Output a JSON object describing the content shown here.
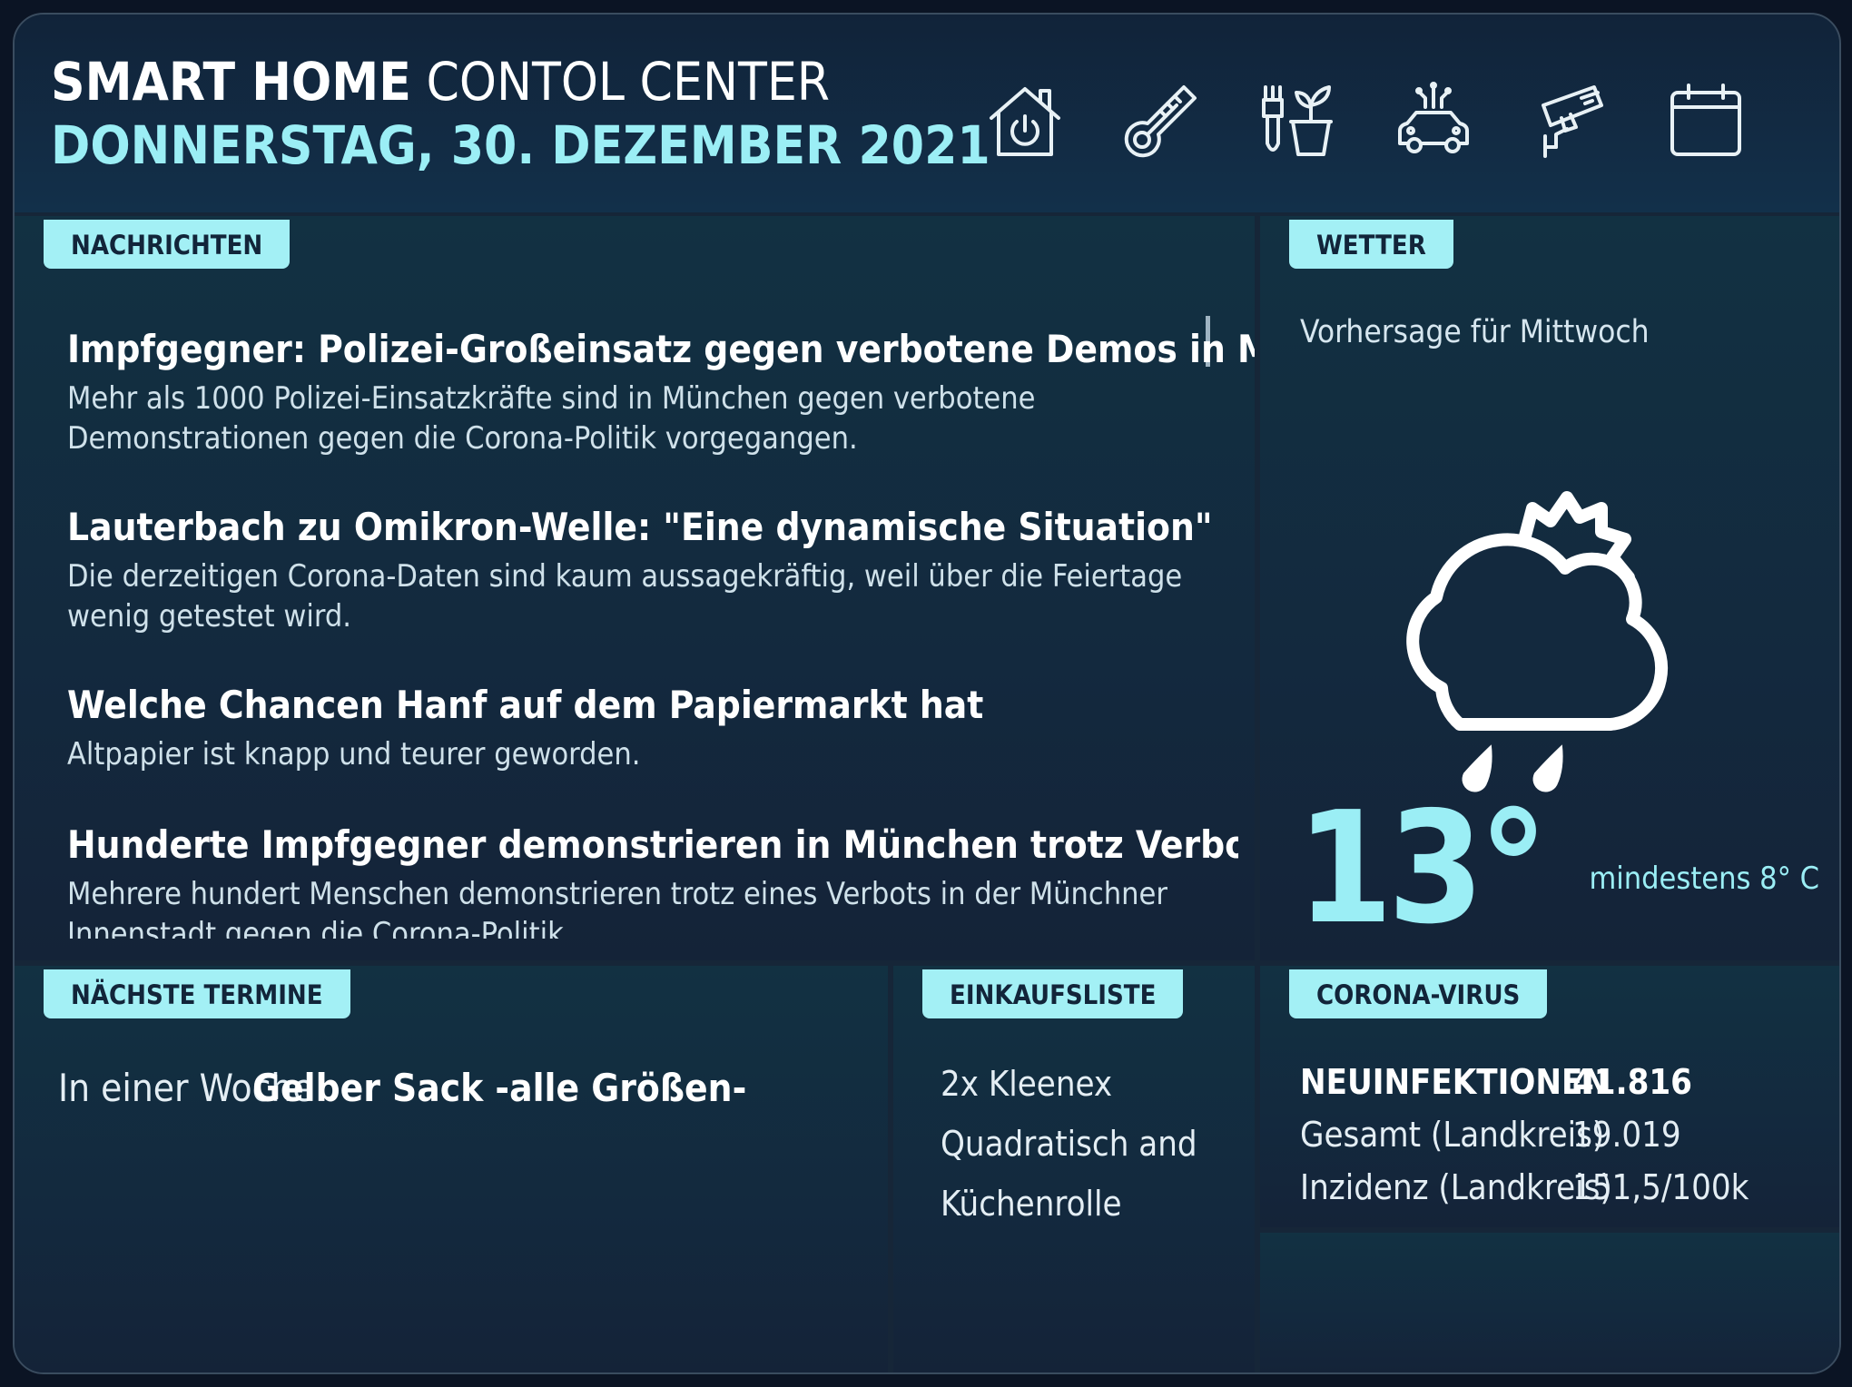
{
  "header": {
    "title_bold": "SMART HOME",
    "title_light": "CONTOL CENTER",
    "date": "DONNERSTAG, 30. DEZEMBER 2021",
    "icons": [
      "smart-home-power-icon",
      "thermometer-icon",
      "garden-plant-icon",
      "connected-car-icon",
      "security-camera-icon",
      "calendar-icon"
    ]
  },
  "news": {
    "tag": "NACHRICHTEN",
    "items": [
      {
        "headline": "Impfgegner: Polizei-Großeinsatz gegen verbotene Demos in München",
        "teaser": "Mehr als 1000 Polizei-Einsatzkräfte sind in München gegen verbotene Demonstrationen gegen die Corona-Politik vorgegangen."
      },
      {
        "headline": "Lauterbach zu Omikron-Welle: \"Eine dynamische Situation\"",
        "teaser": "Die derzeitigen Corona-Daten sind kaum aussagekräftig, weil über die Feiertage wenig getestet wird."
      },
      {
        "headline": "Welche Chancen Hanf auf dem Papiermarkt hat",
        "teaser": "Altpapier ist knapp und teurer geworden."
      },
      {
        "headline": "Hunderte Impfgegner demonstrieren in München trotz Verbots",
        "teaser": "Mehrere hundert Menschen demonstrieren trotz eines Verbots in der Münchner Innenstadt gegen die Corona-Politik."
      }
    ]
  },
  "weather": {
    "tag": "WETTER",
    "subtitle": "Vorhersage für Mittwoch",
    "icon": "partly-cloudy-rain-icon",
    "temperature": "13°",
    "min": "mindestens 8° C"
  },
  "termine": {
    "tag": "NÄCHSTE TERMINE",
    "when": "In einer Woche",
    "what": "Gelber Sack -alle Größen-"
  },
  "einkauf": {
    "tag": "EINKAUFSLISTE",
    "items": [
      "2x Kleenex",
      "Quadratisch and",
      "Küchenrolle"
    ]
  },
  "corona": {
    "tag": "CORONA-VIRUS",
    "rows": [
      {
        "label": "NEUINFEKTIONEN",
        "value": "41.816"
      },
      {
        "label": "Gesamt (Landkreis)",
        "value": "19.019"
      },
      {
        "label": "Inzidenz (Landkreis)",
        "value": "151,5/100k"
      }
    ]
  },
  "colors": {
    "accent": "#9beef5",
    "tag_bg": "#a3f0f5",
    "panel": "#13293e",
    "background": "#0b1424"
  }
}
